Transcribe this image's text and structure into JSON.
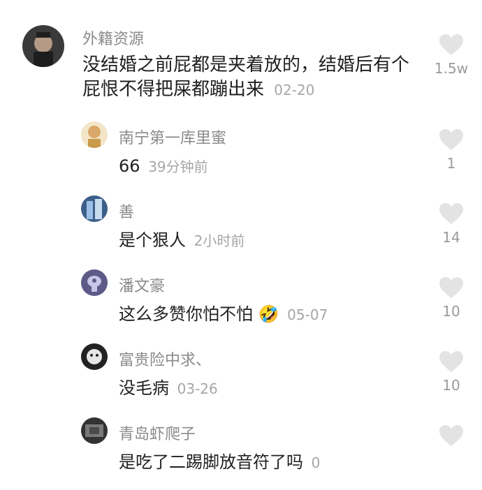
{
  "comments": [
    {
      "user": "外籍资源",
      "text": "没结婚之前屁都是夹着放的，结婚后有个屁恨不得把屎都蹦出来",
      "time": "02-20",
      "likes": "1.5w",
      "avatar_colors": [
        "#2b2b2b",
        "#8a7c70"
      ]
    }
  ],
  "replies": [
    {
      "user": "南宁第一库里蜜",
      "text": "66",
      "time": "39分钟前",
      "likes": "1",
      "avatar_colors": [
        "#f3e6c8",
        "#c89a4a"
      ]
    },
    {
      "user": "善",
      "text": "是个狠人",
      "time": "2小时前",
      "likes": "14",
      "avatar_colors": [
        "#3c5f8a",
        "#9cc0e4"
      ]
    },
    {
      "user": "潘文豪",
      "text": "这么多赞你怕不怕",
      "emoji": "🤣",
      "time": "05-07",
      "likes": "10",
      "avatar_colors": [
        "#5d5a88",
        "#c9c5e8"
      ]
    },
    {
      "user": "富贵险中求、",
      "text": "没毛病",
      "time": "03-26",
      "likes": "10",
      "avatar_colors": [
        "#222222",
        "#e6e6e6"
      ]
    },
    {
      "user": "青岛虾爬子",
      "text": "是吃了二踢脚放音符了吗",
      "time": "0",
      "likes": "",
      "avatar_colors": [
        "#333333",
        "#7a7a7a"
      ]
    }
  ],
  "colors": {
    "heart": "#e3e3e3",
    "username": "#8a8a8a",
    "meta": "#a6a6a6",
    "text": "#1f1f1f"
  },
  "icons": {
    "like": "heart-icon"
  }
}
